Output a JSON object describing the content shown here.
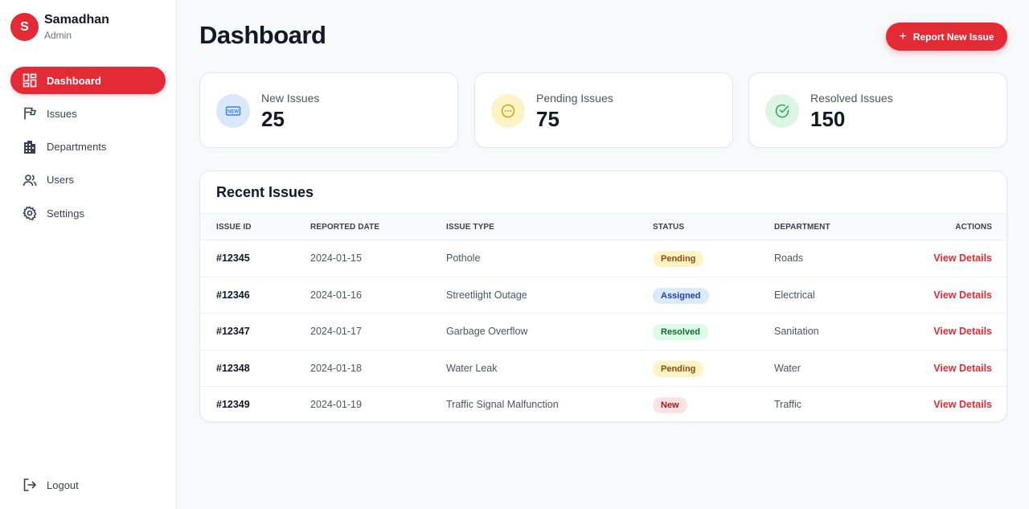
{
  "sidebar": {
    "avatar_letter": "S",
    "app_name": "Samadhan",
    "role": "Admin",
    "items": [
      {
        "label": "Dashboard",
        "icon": "dashboard-icon"
      },
      {
        "label": "Issues",
        "icon": "flag-icon"
      },
      {
        "label": "Departments",
        "icon": "building-icon"
      },
      {
        "label": "Users",
        "icon": "users-icon"
      },
      {
        "label": "Settings",
        "icon": "gear-icon"
      }
    ],
    "logout_label": "Logout"
  },
  "header": {
    "title": "Dashboard",
    "report_button_label": "Report New Issue",
    "report_button_icon": "plus-icon"
  },
  "stats": [
    {
      "label": "New Issues",
      "value": "25",
      "icon": "new-badge-icon",
      "icon_color": "#3b82f6",
      "circle_color": "#dbe7fb"
    },
    {
      "label": "Pending Issues",
      "value": "75",
      "icon": "dots-circle-icon",
      "icon_color": "#d4a017",
      "circle_color": "#fdf3c4"
    },
    {
      "label": "Resolved Issues",
      "value": "150",
      "icon": "check-circle-icon",
      "icon_color": "#22a55a",
      "circle_color": "#dcf6e4"
    }
  ],
  "recent": {
    "title": "Recent Issues",
    "columns": [
      "ISSUE ID",
      "REPORTED DATE",
      "ISSUE TYPE",
      "STATUS",
      "DEPARTMENT",
      "ACTIONS"
    ],
    "rows": [
      {
        "id": "#12345",
        "date": "2024-01-15",
        "type": "Pothole",
        "status": "Pending",
        "department": "Roads",
        "action": "View Details"
      },
      {
        "id": "#12346",
        "date": "2024-01-16",
        "type": "Streetlight Outage",
        "status": "Assigned",
        "department": "Electrical",
        "action": "View Details"
      },
      {
        "id": "#12347",
        "date": "2024-01-17",
        "type": "Garbage Overflow",
        "status": "Resolved",
        "department": "Sanitation",
        "action": "View Details"
      },
      {
        "id": "#12348",
        "date": "2024-01-18",
        "type": "Water Leak",
        "status": "Pending",
        "department": "Water",
        "action": "View Details"
      },
      {
        "id": "#12349",
        "date": "2024-01-19",
        "type": "Traffic Signal Malfunction",
        "status": "New",
        "department": "Traffic",
        "action": "View Details"
      }
    ]
  },
  "colors": {
    "accent": "#e32b36",
    "status_pending_bg": "#fdf3c4",
    "status_pending_fg": "#854d0e",
    "status_assigned_bg": "#dbeafe",
    "status_assigned_fg": "#1e40af",
    "status_resolved_bg": "#dcfce7",
    "status_resolved_fg": "#166534",
    "status_new_bg": "#fde2e4",
    "status_new_fg": "#991b1b"
  }
}
